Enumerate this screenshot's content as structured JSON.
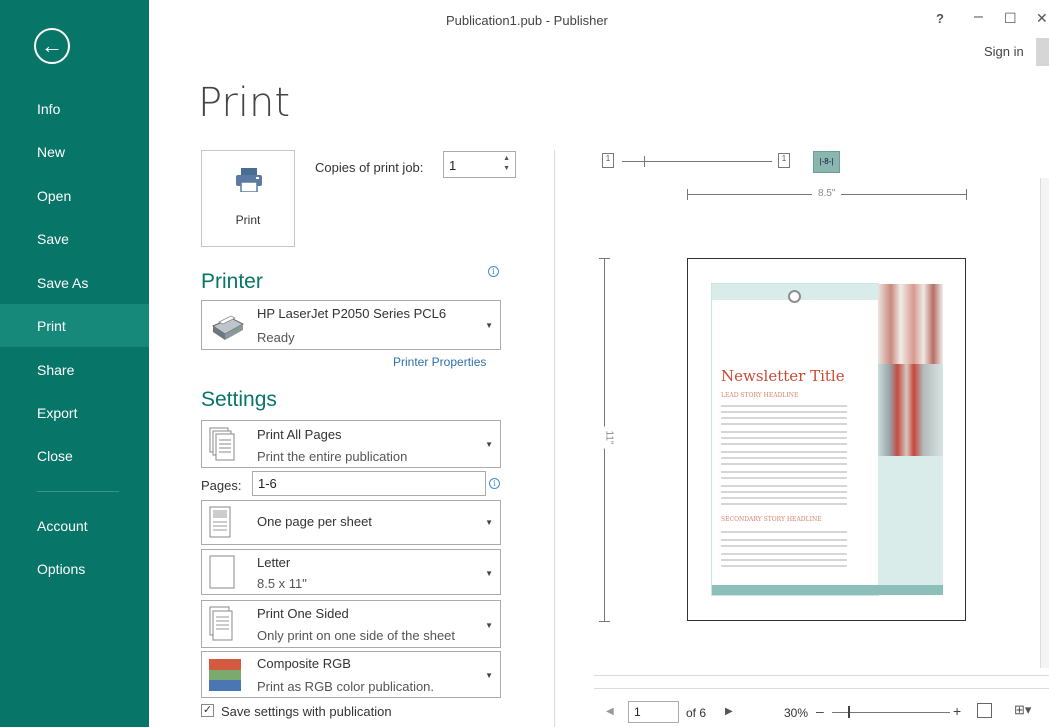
{
  "window": {
    "title": "Publication1.pub - Publisher",
    "help": "?",
    "minimize": "–",
    "maximize": "☐",
    "close": "✕",
    "sign_in": "Sign in"
  },
  "sidebar": {
    "back": "←",
    "items": [
      {
        "label": "Info"
      },
      {
        "label": "New"
      },
      {
        "label": "Open"
      },
      {
        "label": "Save"
      },
      {
        "label": "Save As"
      },
      {
        "label": "Print",
        "active": true
      },
      {
        "label": "Share"
      },
      {
        "label": "Export"
      },
      {
        "label": "Close"
      },
      {
        "label": "Account"
      },
      {
        "label": "Options"
      }
    ],
    "accent": "#077568"
  },
  "main": {
    "title": "Print",
    "print_button": "Print",
    "copies_label": "Copies of print job:",
    "copies_value": "1",
    "printer": {
      "heading": "Printer",
      "name": "HP LaserJet P2050 Series PCL6",
      "status": "Ready",
      "properties_link": "Printer Properties"
    },
    "settings": {
      "heading": "Settings",
      "range": {
        "title": "Print All Pages",
        "desc": "Print the entire publication"
      },
      "pages_label": "Pages:",
      "pages_value": "1-6",
      "layout": {
        "title": "One page per sheet"
      },
      "paper": {
        "title": "Letter",
        "desc": "8.5 x 11\""
      },
      "sides": {
        "title": "Print One Sided",
        "desc": "Only print on one side of the sheet"
      },
      "color": {
        "title": "Composite RGB",
        "desc": "Print as RGB color publication."
      },
      "save_settings": "Save settings with publication"
    }
  },
  "preview": {
    "ruler_h": "8.5\"",
    "ruler_v": "11\"",
    "newsletter_title": "Newsletter Title",
    "lead_heading": "LEAD STORY HEADLINE",
    "secondary_heading": "SECONDARY STORY HEADLINE",
    "page_current": "1",
    "page_of": "of 6",
    "zoom": "30%"
  }
}
